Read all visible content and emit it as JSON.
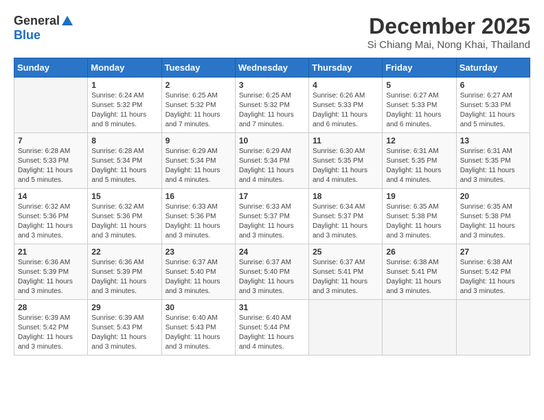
{
  "header": {
    "logo_general": "General",
    "logo_blue": "Blue",
    "month": "December 2025",
    "location": "Si Chiang Mai, Nong Khai, Thailand"
  },
  "days_of_week": [
    "Sunday",
    "Monday",
    "Tuesday",
    "Wednesday",
    "Thursday",
    "Friday",
    "Saturday"
  ],
  "weeks": [
    [
      {
        "day": "",
        "sunrise": "",
        "sunset": "",
        "daylight": ""
      },
      {
        "day": "1",
        "sunrise": "Sunrise: 6:24 AM",
        "sunset": "Sunset: 5:32 PM",
        "daylight": "Daylight: 11 hours and 8 minutes."
      },
      {
        "day": "2",
        "sunrise": "Sunrise: 6:25 AM",
        "sunset": "Sunset: 5:32 PM",
        "daylight": "Daylight: 11 hours and 7 minutes."
      },
      {
        "day": "3",
        "sunrise": "Sunrise: 6:25 AM",
        "sunset": "Sunset: 5:32 PM",
        "daylight": "Daylight: 11 hours and 7 minutes."
      },
      {
        "day": "4",
        "sunrise": "Sunrise: 6:26 AM",
        "sunset": "Sunset: 5:33 PM",
        "daylight": "Daylight: 11 hours and 6 minutes."
      },
      {
        "day": "5",
        "sunrise": "Sunrise: 6:27 AM",
        "sunset": "Sunset: 5:33 PM",
        "daylight": "Daylight: 11 hours and 6 minutes."
      },
      {
        "day": "6",
        "sunrise": "Sunrise: 6:27 AM",
        "sunset": "Sunset: 5:33 PM",
        "daylight": "Daylight: 11 hours and 5 minutes."
      }
    ],
    [
      {
        "day": "7",
        "sunrise": "Sunrise: 6:28 AM",
        "sunset": "Sunset: 5:33 PM",
        "daylight": "Daylight: 11 hours and 5 minutes."
      },
      {
        "day": "8",
        "sunrise": "Sunrise: 6:28 AM",
        "sunset": "Sunset: 5:34 PM",
        "daylight": "Daylight: 11 hours and 5 minutes."
      },
      {
        "day": "9",
        "sunrise": "Sunrise: 6:29 AM",
        "sunset": "Sunset: 5:34 PM",
        "daylight": "Daylight: 11 hours and 4 minutes."
      },
      {
        "day": "10",
        "sunrise": "Sunrise: 6:29 AM",
        "sunset": "Sunset: 5:34 PM",
        "daylight": "Daylight: 11 hours and 4 minutes."
      },
      {
        "day": "11",
        "sunrise": "Sunrise: 6:30 AM",
        "sunset": "Sunset: 5:35 PM",
        "daylight": "Daylight: 11 hours and 4 minutes."
      },
      {
        "day": "12",
        "sunrise": "Sunrise: 6:31 AM",
        "sunset": "Sunset: 5:35 PM",
        "daylight": "Daylight: 11 hours and 4 minutes."
      },
      {
        "day": "13",
        "sunrise": "Sunrise: 6:31 AM",
        "sunset": "Sunset: 5:35 PM",
        "daylight": "Daylight: 11 hours and 3 minutes."
      }
    ],
    [
      {
        "day": "14",
        "sunrise": "Sunrise: 6:32 AM",
        "sunset": "Sunset: 5:36 PM",
        "daylight": "Daylight: 11 hours and 3 minutes."
      },
      {
        "day": "15",
        "sunrise": "Sunrise: 6:32 AM",
        "sunset": "Sunset: 5:36 PM",
        "daylight": "Daylight: 11 hours and 3 minutes."
      },
      {
        "day": "16",
        "sunrise": "Sunrise: 6:33 AM",
        "sunset": "Sunset: 5:36 PM",
        "daylight": "Daylight: 11 hours and 3 minutes."
      },
      {
        "day": "17",
        "sunrise": "Sunrise: 6:33 AM",
        "sunset": "Sunset: 5:37 PM",
        "daylight": "Daylight: 11 hours and 3 minutes."
      },
      {
        "day": "18",
        "sunrise": "Sunrise: 6:34 AM",
        "sunset": "Sunset: 5:37 PM",
        "daylight": "Daylight: 11 hours and 3 minutes."
      },
      {
        "day": "19",
        "sunrise": "Sunrise: 6:35 AM",
        "sunset": "Sunset: 5:38 PM",
        "daylight": "Daylight: 11 hours and 3 minutes."
      },
      {
        "day": "20",
        "sunrise": "Sunrise: 6:35 AM",
        "sunset": "Sunset: 5:38 PM",
        "daylight": "Daylight: 11 hours and 3 minutes."
      }
    ],
    [
      {
        "day": "21",
        "sunrise": "Sunrise: 6:36 AM",
        "sunset": "Sunset: 5:39 PM",
        "daylight": "Daylight: 11 hours and 3 minutes."
      },
      {
        "day": "22",
        "sunrise": "Sunrise: 6:36 AM",
        "sunset": "Sunset: 5:39 PM",
        "daylight": "Daylight: 11 hours and 3 minutes."
      },
      {
        "day": "23",
        "sunrise": "Sunrise: 6:37 AM",
        "sunset": "Sunset: 5:40 PM",
        "daylight": "Daylight: 11 hours and 3 minutes."
      },
      {
        "day": "24",
        "sunrise": "Sunrise: 6:37 AM",
        "sunset": "Sunset: 5:40 PM",
        "daylight": "Daylight: 11 hours and 3 minutes."
      },
      {
        "day": "25",
        "sunrise": "Sunrise: 6:37 AM",
        "sunset": "Sunset: 5:41 PM",
        "daylight": "Daylight: 11 hours and 3 minutes."
      },
      {
        "day": "26",
        "sunrise": "Sunrise: 6:38 AM",
        "sunset": "Sunset: 5:41 PM",
        "daylight": "Daylight: 11 hours and 3 minutes."
      },
      {
        "day": "27",
        "sunrise": "Sunrise: 6:38 AM",
        "sunset": "Sunset: 5:42 PM",
        "daylight": "Daylight: 11 hours and 3 minutes."
      }
    ],
    [
      {
        "day": "28",
        "sunrise": "Sunrise: 6:39 AM",
        "sunset": "Sunset: 5:42 PM",
        "daylight": "Daylight: 11 hours and 3 minutes."
      },
      {
        "day": "29",
        "sunrise": "Sunrise: 6:39 AM",
        "sunset": "Sunset: 5:43 PM",
        "daylight": "Daylight: 11 hours and 3 minutes."
      },
      {
        "day": "30",
        "sunrise": "Sunrise: 6:40 AM",
        "sunset": "Sunset: 5:43 PM",
        "daylight": "Daylight: 11 hours and 3 minutes."
      },
      {
        "day": "31",
        "sunrise": "Sunrise: 6:40 AM",
        "sunset": "Sunset: 5:44 PM",
        "daylight": "Daylight: 11 hours and 4 minutes."
      },
      {
        "day": "",
        "sunrise": "",
        "sunset": "",
        "daylight": ""
      },
      {
        "day": "",
        "sunrise": "",
        "sunset": "",
        "daylight": ""
      },
      {
        "day": "",
        "sunrise": "",
        "sunset": "",
        "daylight": ""
      }
    ]
  ]
}
